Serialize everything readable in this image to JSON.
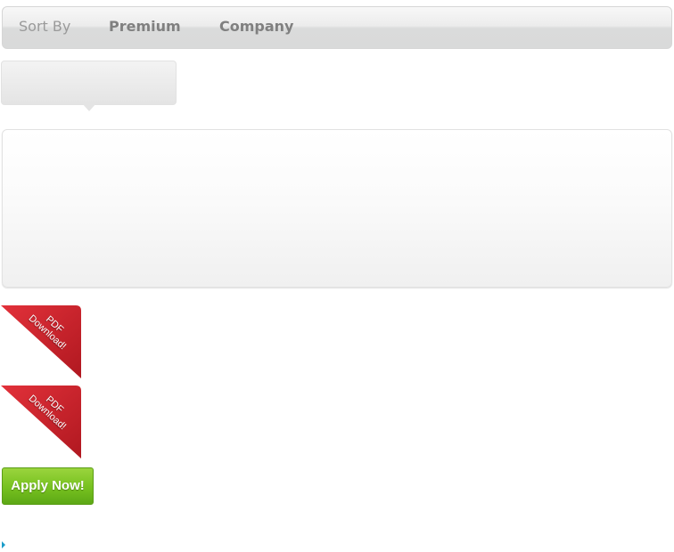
{
  "sortbar": {
    "label": "Sort By",
    "options": [
      "Premium",
      "Company"
    ]
  },
  "ribbons": [
    {
      "line1": "PDF",
      "line2": "Download!",
      "icon": "pdf-download-ribbon-icon"
    },
    {
      "line1": "PDF",
      "line2": "Download!",
      "icon": "pdf-download-ribbon-icon"
    }
  ],
  "apply_button": {
    "label": "Apply Now!"
  },
  "colors": {
    "ribbon_red": "#d5252e",
    "apply_green": "#7cc423",
    "arrow_blue": "#1a9cc9"
  }
}
